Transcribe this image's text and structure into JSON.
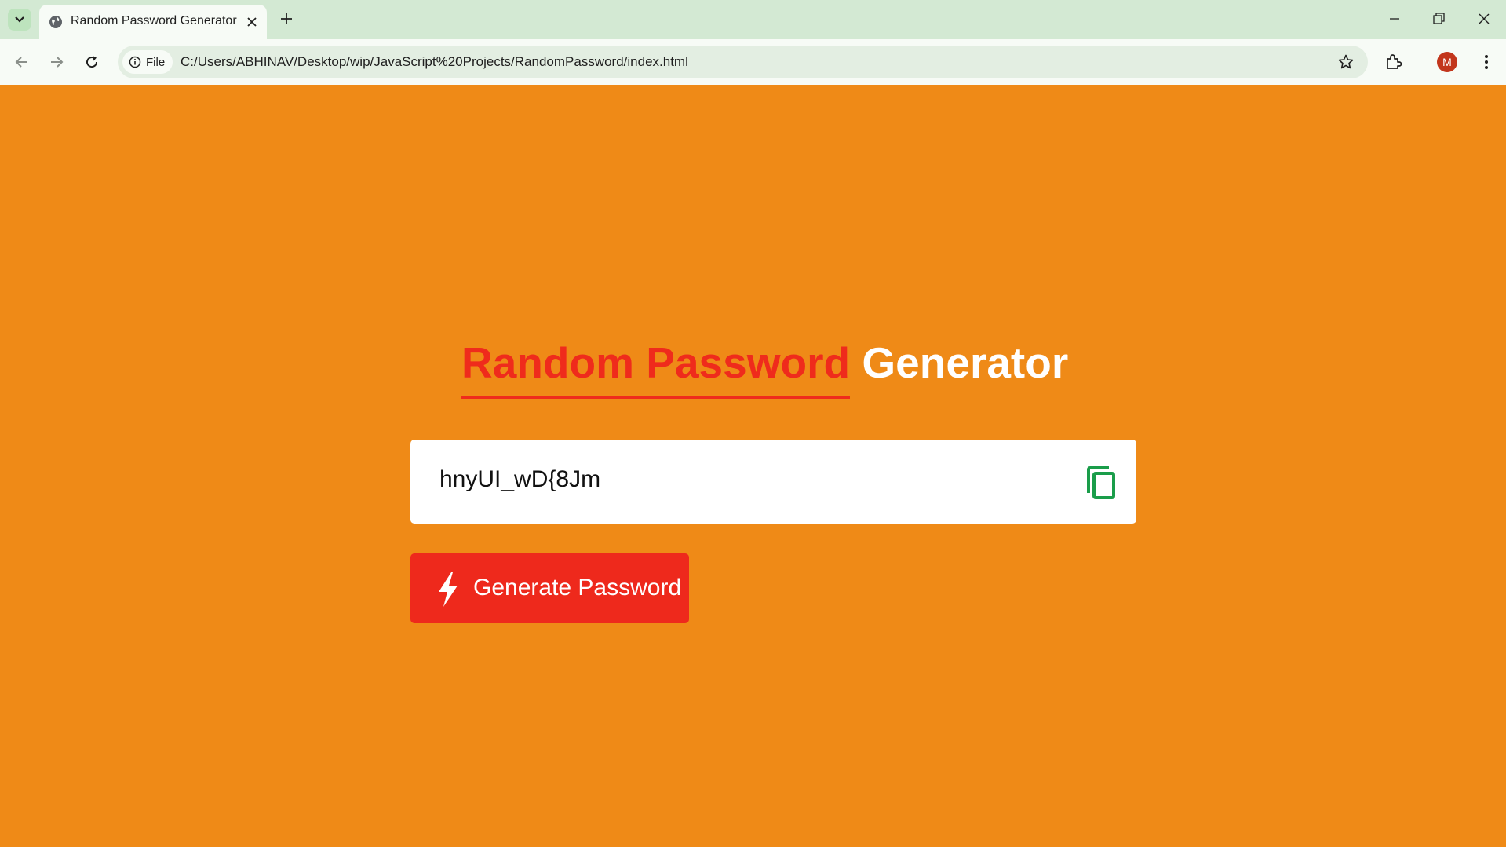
{
  "browser": {
    "tab": {
      "title": "Random Password Generator"
    },
    "address_bar": {
      "scheme_chip": "File",
      "url": "C:/Users/ABHINAV/Desktop/wip/JavaScript%20Projects/RandomPassword/index.html"
    },
    "profile": {
      "initial": "M",
      "color": "#c2361c"
    },
    "icons": [
      "tab-search-icon",
      "globe-icon",
      "close-icon",
      "plus-icon",
      "minimize-icon",
      "restore-icon",
      "back-icon",
      "forward-icon",
      "reload-icon",
      "info-icon",
      "star-icon",
      "extensions-icon",
      "kebab-menu-icon"
    ]
  },
  "page": {
    "background_color": "#ef8a17",
    "accent_color": "#ef2b1c",
    "heading": {
      "accent": "Random Password",
      "rest": "Generator"
    },
    "password_field": {
      "value": "hnyUI_wD{8Jm",
      "copy_icon": "copy-icon",
      "icon_color": "#1a9d4a"
    },
    "generate_button": {
      "label": "Generate Password",
      "icon": "lightning-bolt-icon"
    }
  }
}
